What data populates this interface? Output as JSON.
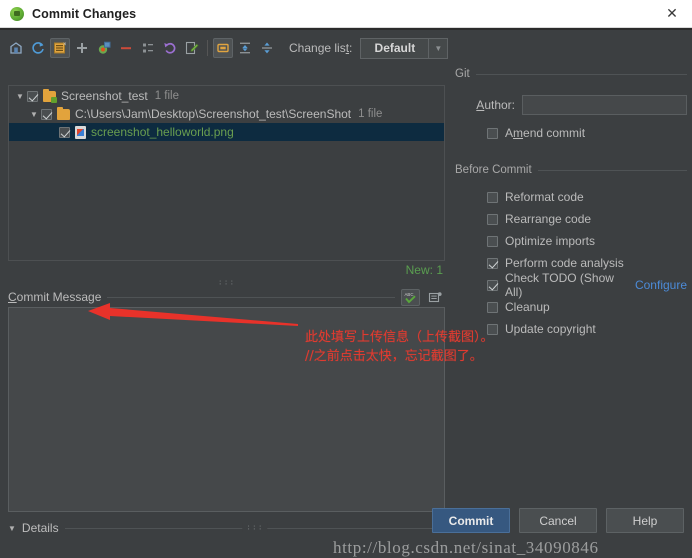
{
  "window": {
    "title": "Commit Changes",
    "app_icon": "intellij-icon",
    "close_label": "✕"
  },
  "toolbar": {
    "icons": [
      {
        "name": "show-diff-icon",
        "glyph": "diff"
      },
      {
        "name": "refresh-icon",
        "glyph": "refresh"
      },
      {
        "name": "new-changelist-icon",
        "glyph": "changelist"
      },
      {
        "name": "add-icon",
        "glyph": "plus"
      },
      {
        "name": "move-to-changelist-icon",
        "glyph": "move"
      },
      {
        "name": "remove-icon",
        "glyph": "minus"
      },
      {
        "name": "group-by-directory-icon",
        "glyph": "tree"
      },
      {
        "name": "revert-icon",
        "glyph": "undo"
      },
      {
        "name": "edit-source-icon",
        "glyph": "edit"
      },
      {
        "name": "group-by-module-icon",
        "glyph": "module"
      },
      {
        "name": "expand-all-icon",
        "glyph": "expand"
      },
      {
        "name": "collapse-all-icon",
        "glyph": "collapse"
      }
    ],
    "changelist_label_before": "Change lis",
    "changelist_label_mnemonic": "t",
    "changelist_label_after": ":",
    "changelist_value": "Default",
    "changelist_arrow": "▼"
  },
  "file_tree": {
    "rows": [
      {
        "name": "tree-row-changelist",
        "twisty": "▼",
        "checked": true,
        "icon": "folder-green-badge-icon",
        "label": "Screenshot_test",
        "count": "1 file",
        "indent": 0,
        "selected": false,
        "green": false
      },
      {
        "name": "tree-row-directory",
        "twisty": "▼",
        "checked": true,
        "icon": "folder-icon",
        "label": "C:\\Users\\Jam\\Desktop\\Screenshot_test\\ScreenShot",
        "count": "1 file",
        "indent": 1,
        "selected": false,
        "green": false
      },
      {
        "name": "tree-row-file",
        "twisty": "",
        "checked": true,
        "icon": "image-file-icon",
        "label": "screenshot_helloworld.png",
        "count": "",
        "indent": 2,
        "selected": true,
        "green": true
      }
    ]
  },
  "new_count": "New: 1",
  "splitter_dots": "∶∶∶",
  "commit_message": {
    "label_first": "C",
    "label_rest": "ommit Message",
    "value": "",
    "icons": [
      {
        "name": "spellcheck-icon",
        "framed": true
      },
      {
        "name": "message-history-icon",
        "framed": false
      }
    ]
  },
  "details": {
    "twisty": "▼",
    "label": "Details",
    "dots": "∶∶∶"
  },
  "git_panel": {
    "group_label": "Git",
    "author_label_first": "A",
    "author_label_rest": "uthor:",
    "author_value": "",
    "amend": {
      "label_before": "A",
      "label_mnemonic": "m",
      "label_after": "end commit",
      "checked": false
    }
  },
  "before_commit": {
    "group_label": "Before Commit",
    "items": [
      {
        "name": "reformat-code-checkbox",
        "label": "Reformat code",
        "checked": false,
        "link": ""
      },
      {
        "name": "rearrange-code-checkbox",
        "label": "Rearrange code",
        "checked": false,
        "link": ""
      },
      {
        "name": "optimize-imports-checkbox",
        "label": "Optimize imports",
        "checked": false,
        "link": ""
      },
      {
        "name": "perform-code-analysis-checkbox",
        "label": "Perform code analysis",
        "checked": true,
        "link": ""
      },
      {
        "name": "check-todo-checkbox",
        "label": "Check TODO (Show All)",
        "checked": true,
        "link": "Configure"
      },
      {
        "name": "cleanup-checkbox",
        "label": "Cleanup",
        "checked": false,
        "link": ""
      },
      {
        "name": "update-copyright-checkbox",
        "label": "Update copyright",
        "checked": false,
        "link": ""
      }
    ]
  },
  "buttons": {
    "commit": "Commit",
    "cancel": "Cancel",
    "help": "Help"
  },
  "annotations": {
    "line1": "此处填写上传信息（上传截图）。",
    "line2": "//之前点击太快，忘记截图了。",
    "arrow_color": "#e8322a"
  },
  "watermark": "http://blog.csdn.net/sinat_34090846",
  "colors": {
    "window_bg": "#3c3f41",
    "titlebar_bg": "#ffffff",
    "accent_blue": "#365880",
    "link_blue": "#4c8bd8",
    "new_green": "#5a9e50",
    "selected_row": "#0d2b40",
    "annotation_red": "#e03b30"
  }
}
